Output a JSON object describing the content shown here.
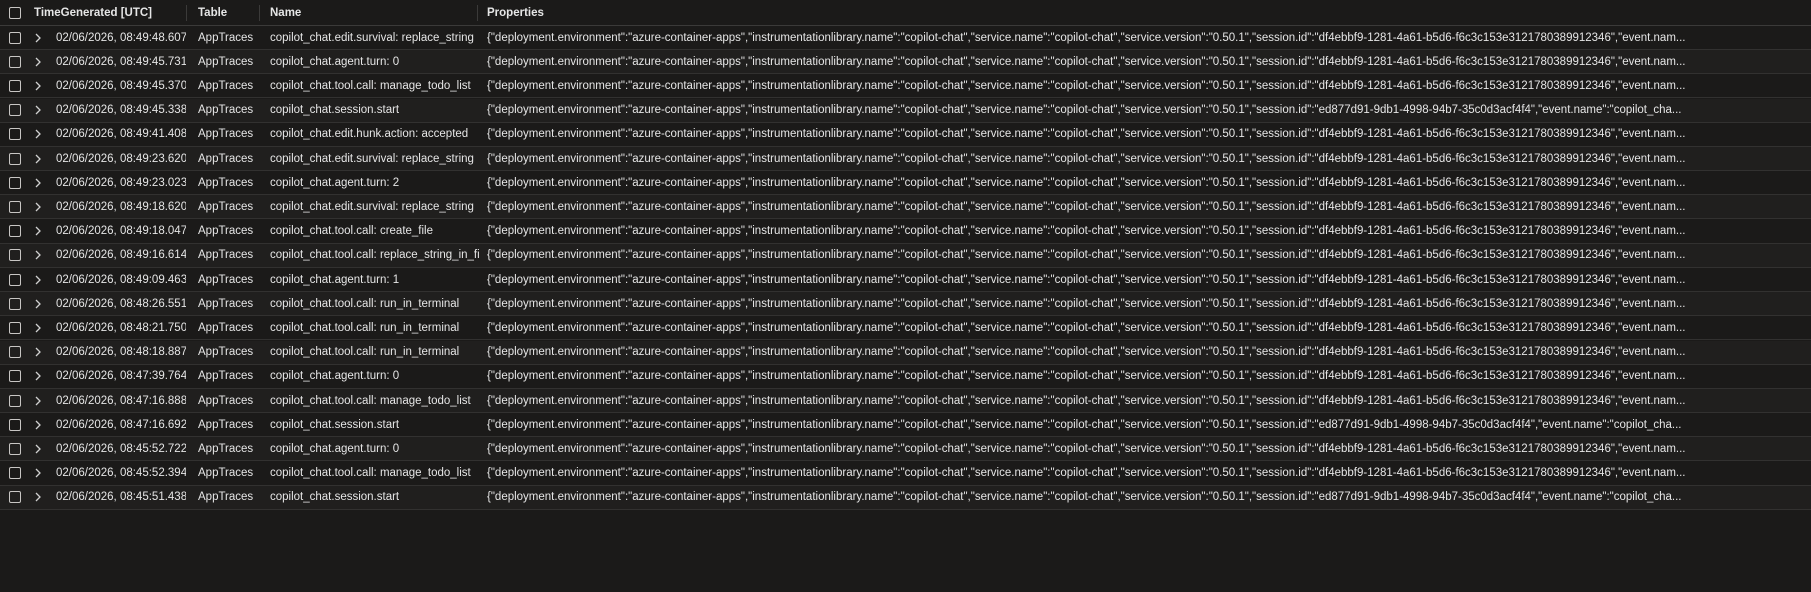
{
  "columns": {
    "time": "TimeGenerated [UTC]",
    "table": "Table",
    "name": "Name",
    "properties": "Properties"
  },
  "rows": [
    {
      "time": "02/06/2026, 08:49:48.607",
      "table": "AppTraces",
      "name": "copilot_chat.edit.survival: replace_string",
      "properties": "{\"deployment.environment\":\"azure-container-apps\",\"instrumentationlibrary.name\":\"copilot-chat\",\"service.name\":\"copilot-chat\",\"service.version\":\"0.50.1\",\"session.id\":\"df4ebbf9-1281-4a61-b5d6-f6c3c153e3121780389912346\",\"event.nam..."
    },
    {
      "time": "02/06/2026, 08:49:45.731",
      "table": "AppTraces",
      "name": "copilot_chat.agent.turn: 0",
      "properties": "{\"deployment.environment\":\"azure-container-apps\",\"instrumentationlibrary.name\":\"copilot-chat\",\"service.name\":\"copilot-chat\",\"service.version\":\"0.50.1\",\"session.id\":\"df4ebbf9-1281-4a61-b5d6-f6c3c153e3121780389912346\",\"event.nam..."
    },
    {
      "time": "02/06/2026, 08:49:45.370",
      "table": "AppTraces",
      "name": "copilot_chat.tool.call: manage_todo_list",
      "properties": "{\"deployment.environment\":\"azure-container-apps\",\"instrumentationlibrary.name\":\"copilot-chat\",\"service.name\":\"copilot-chat\",\"service.version\":\"0.50.1\",\"session.id\":\"df4ebbf9-1281-4a61-b5d6-f6c3c153e3121780389912346\",\"event.nam..."
    },
    {
      "time": "02/06/2026, 08:49:45.338",
      "table": "AppTraces",
      "name": "copilot_chat.session.start",
      "properties": "{\"deployment.environment\":\"azure-container-apps\",\"instrumentationlibrary.name\":\"copilot-chat\",\"service.name\":\"copilot-chat\",\"service.version\":\"0.50.1\",\"session.id\":\"ed877d91-9db1-4998-94b7-35c0d3acf4f4\",\"event.name\":\"copilot_cha..."
    },
    {
      "time": "02/06/2026, 08:49:41.408",
      "table": "AppTraces",
      "name": "copilot_chat.edit.hunk.action: accepted",
      "properties": "{\"deployment.environment\":\"azure-container-apps\",\"instrumentationlibrary.name\":\"copilot-chat\",\"service.name\":\"copilot-chat\",\"service.version\":\"0.50.1\",\"session.id\":\"df4ebbf9-1281-4a61-b5d6-f6c3c153e3121780389912346\",\"event.nam..."
    },
    {
      "time": "02/06/2026, 08:49:23.620",
      "table": "AppTraces",
      "name": "copilot_chat.edit.survival: replace_string",
      "properties": "{\"deployment.environment\":\"azure-container-apps\",\"instrumentationlibrary.name\":\"copilot-chat\",\"service.name\":\"copilot-chat\",\"service.version\":\"0.50.1\",\"session.id\":\"df4ebbf9-1281-4a61-b5d6-f6c3c153e3121780389912346\",\"event.nam..."
    },
    {
      "time": "02/06/2026, 08:49:23.023",
      "table": "AppTraces",
      "name": "copilot_chat.agent.turn: 2",
      "properties": "{\"deployment.environment\":\"azure-container-apps\",\"instrumentationlibrary.name\":\"copilot-chat\",\"service.name\":\"copilot-chat\",\"service.version\":\"0.50.1\",\"session.id\":\"df4ebbf9-1281-4a61-b5d6-f6c3c153e3121780389912346\",\"event.nam..."
    },
    {
      "time": "02/06/2026, 08:49:18.620",
      "table": "AppTraces",
      "name": "copilot_chat.edit.survival: replace_string",
      "properties": "{\"deployment.environment\":\"azure-container-apps\",\"instrumentationlibrary.name\":\"copilot-chat\",\"service.name\":\"copilot-chat\",\"service.version\":\"0.50.1\",\"session.id\":\"df4ebbf9-1281-4a61-b5d6-f6c3c153e3121780389912346\",\"event.nam..."
    },
    {
      "time": "02/06/2026, 08:49:18.047",
      "table": "AppTraces",
      "name": "copilot_chat.tool.call: create_file",
      "properties": "{\"deployment.environment\":\"azure-container-apps\",\"instrumentationlibrary.name\":\"copilot-chat\",\"service.name\":\"copilot-chat\",\"service.version\":\"0.50.1\",\"session.id\":\"df4ebbf9-1281-4a61-b5d6-f6c3c153e3121780389912346\",\"event.nam..."
    },
    {
      "time": "02/06/2026, 08:49:16.614",
      "table": "AppTraces",
      "name": "copilot_chat.tool.call: replace_string_in_file",
      "properties": "{\"deployment.environment\":\"azure-container-apps\",\"instrumentationlibrary.name\":\"copilot-chat\",\"service.name\":\"copilot-chat\",\"service.version\":\"0.50.1\",\"session.id\":\"df4ebbf9-1281-4a61-b5d6-f6c3c153e3121780389912346\",\"event.nam..."
    },
    {
      "time": "02/06/2026, 08:49:09.463",
      "table": "AppTraces",
      "name": "copilot_chat.agent.turn: 1",
      "properties": "{\"deployment.environment\":\"azure-container-apps\",\"instrumentationlibrary.name\":\"copilot-chat\",\"service.name\":\"copilot-chat\",\"service.version\":\"0.50.1\",\"session.id\":\"df4ebbf9-1281-4a61-b5d6-f6c3c153e3121780389912346\",\"event.nam..."
    },
    {
      "time": "02/06/2026, 08:48:26.551",
      "table": "AppTraces",
      "name": "copilot_chat.tool.call: run_in_terminal",
      "properties": "{\"deployment.environment\":\"azure-container-apps\",\"instrumentationlibrary.name\":\"copilot-chat\",\"service.name\":\"copilot-chat\",\"service.version\":\"0.50.1\",\"session.id\":\"df4ebbf9-1281-4a61-b5d6-f6c3c153e3121780389912346\",\"event.nam..."
    },
    {
      "time": "02/06/2026, 08:48:21.750",
      "table": "AppTraces",
      "name": "copilot_chat.tool.call: run_in_terminal",
      "properties": "{\"deployment.environment\":\"azure-container-apps\",\"instrumentationlibrary.name\":\"copilot-chat\",\"service.name\":\"copilot-chat\",\"service.version\":\"0.50.1\",\"session.id\":\"df4ebbf9-1281-4a61-b5d6-f6c3c153e3121780389912346\",\"event.nam..."
    },
    {
      "time": "02/06/2026, 08:48:18.887",
      "table": "AppTraces",
      "name": "copilot_chat.tool.call: run_in_terminal",
      "properties": "{\"deployment.environment\":\"azure-container-apps\",\"instrumentationlibrary.name\":\"copilot-chat\",\"service.name\":\"copilot-chat\",\"service.version\":\"0.50.1\",\"session.id\":\"df4ebbf9-1281-4a61-b5d6-f6c3c153e3121780389912346\",\"event.nam..."
    },
    {
      "time": "02/06/2026, 08:47:39.764",
      "table": "AppTraces",
      "name": "copilot_chat.agent.turn: 0",
      "properties": "{\"deployment.environment\":\"azure-container-apps\",\"instrumentationlibrary.name\":\"copilot-chat\",\"service.name\":\"copilot-chat\",\"service.version\":\"0.50.1\",\"session.id\":\"df4ebbf9-1281-4a61-b5d6-f6c3c153e3121780389912346\",\"event.nam..."
    },
    {
      "time": "02/06/2026, 08:47:16.888",
      "table": "AppTraces",
      "name": "copilot_chat.tool.call: manage_todo_list",
      "properties": "{\"deployment.environment\":\"azure-container-apps\",\"instrumentationlibrary.name\":\"copilot-chat\",\"service.name\":\"copilot-chat\",\"service.version\":\"0.50.1\",\"session.id\":\"df4ebbf9-1281-4a61-b5d6-f6c3c153e3121780389912346\",\"event.nam..."
    },
    {
      "time": "02/06/2026, 08:47:16.692",
      "table": "AppTraces",
      "name": "copilot_chat.session.start",
      "properties": "{\"deployment.environment\":\"azure-container-apps\",\"instrumentationlibrary.name\":\"copilot-chat\",\"service.name\":\"copilot-chat\",\"service.version\":\"0.50.1\",\"session.id\":\"ed877d91-9db1-4998-94b7-35c0d3acf4f4\",\"event.name\":\"copilot_cha..."
    },
    {
      "time": "02/06/2026, 08:45:52.722",
      "table": "AppTraces",
      "name": "copilot_chat.agent.turn: 0",
      "properties": "{\"deployment.environment\":\"azure-container-apps\",\"instrumentationlibrary.name\":\"copilot-chat\",\"service.name\":\"copilot-chat\",\"service.version\":\"0.50.1\",\"session.id\":\"df4ebbf9-1281-4a61-b5d6-f6c3c153e3121780389912346\",\"event.nam..."
    },
    {
      "time": "02/06/2026, 08:45:52.394",
      "table": "AppTraces",
      "name": "copilot_chat.tool.call: manage_todo_list",
      "properties": "{\"deployment.environment\":\"azure-container-apps\",\"instrumentationlibrary.name\":\"copilot-chat\",\"service.name\":\"copilot-chat\",\"service.version\":\"0.50.1\",\"session.id\":\"df4ebbf9-1281-4a61-b5d6-f6c3c153e3121780389912346\",\"event.nam..."
    },
    {
      "time": "02/06/2026, 08:45:51.438",
      "table": "AppTraces",
      "name": "copilot_chat.session.start",
      "properties": "{\"deployment.environment\":\"azure-container-apps\",\"instrumentationlibrary.name\":\"copilot-chat\",\"service.name\":\"copilot-chat\",\"service.version\":\"0.50.1\",\"session.id\":\"ed877d91-9db1-4998-94b7-35c0d3acf4f4\",\"event.name\":\"copilot_cha..."
    }
  ]
}
